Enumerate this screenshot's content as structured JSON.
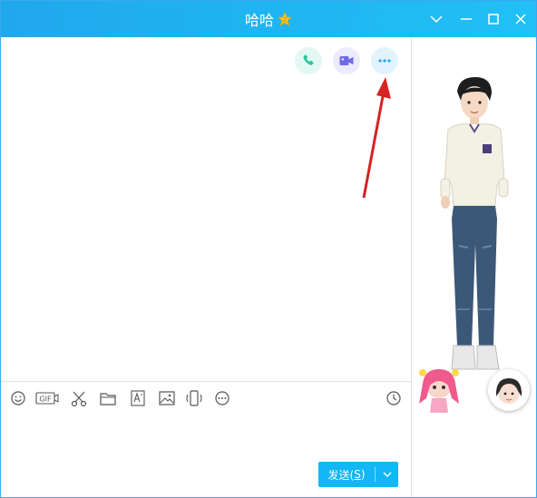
{
  "window": {
    "title": "哈哈",
    "accent_color": "#20a8ec",
    "badge_icon": "star-badge-icon",
    "controls": [
      "chevron-down-icon",
      "minimize-icon",
      "maximize-icon",
      "close-icon"
    ]
  },
  "chat": {
    "call_buttons": [
      {
        "name": "voice-call-button",
        "icon": "phone-icon",
        "color": "#25c7a0"
      },
      {
        "name": "video-call-button",
        "icon": "video-camera-icon",
        "color": "#6f6be8"
      },
      {
        "name": "more-options-button",
        "icon": "more-dots-icon",
        "color": "#2aa9f0"
      }
    ],
    "annotation": "red-arrow-pointing-to-more-button"
  },
  "toolbar": {
    "tools": [
      {
        "name": "emoji-icon"
      },
      {
        "name": "gif-icon",
        "label": "GIF"
      },
      {
        "name": "screenshot-scissors-icon"
      },
      {
        "name": "folder-icon"
      },
      {
        "name": "font-style-icon"
      },
      {
        "name": "image-icon"
      },
      {
        "name": "shake-window-icon"
      },
      {
        "name": "more-tools-icon"
      }
    ],
    "history_icon": "clock-icon"
  },
  "input": {
    "send_label_prefix": "发送(",
    "send_label_key": "S",
    "send_label_suffix": ")",
    "send_color": "#12b7f5"
  },
  "side_panel": {
    "show_avatar": "boy-show-figure",
    "pet_avatar": "anime-girl-avatar",
    "friend_avatar": "friend-avatar"
  }
}
